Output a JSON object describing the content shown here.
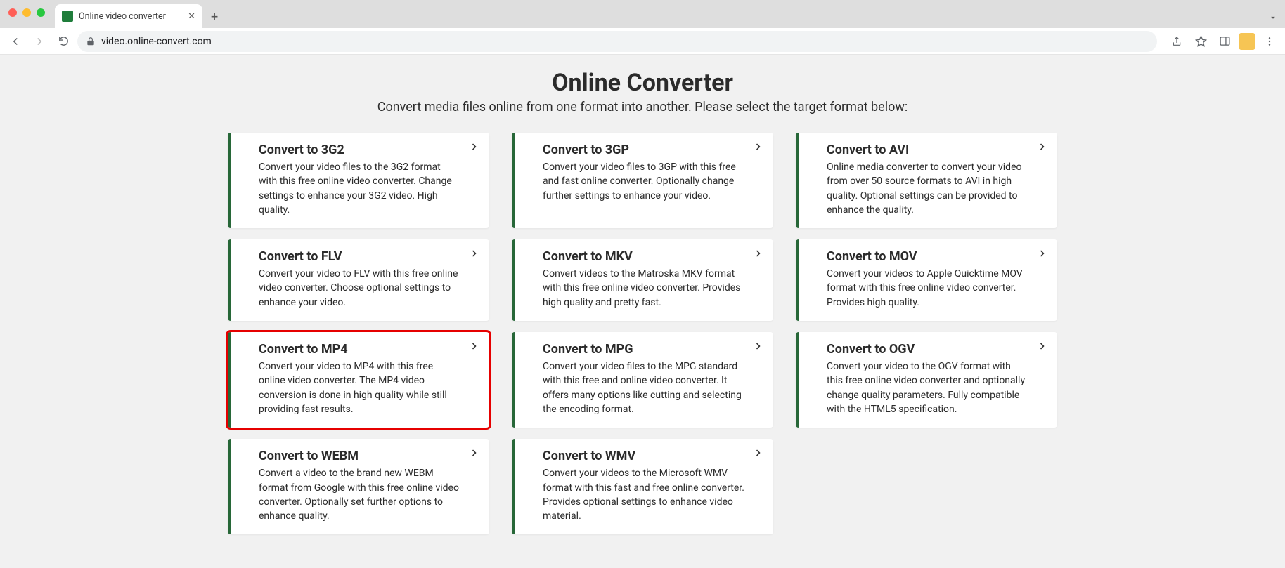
{
  "browser": {
    "tab_title": "Online video converter",
    "url": "video.online-convert.com"
  },
  "page": {
    "title": "Online Converter",
    "subtitle": "Convert media files online from one format into another. Please select the target format below:"
  },
  "cards": [
    {
      "title": "Convert to 3G2",
      "desc": "Convert your video files to the 3G2 format with this free online video converter. Change settings to enhance your 3G2 video. High quality.",
      "highlight": false
    },
    {
      "title": "Convert to 3GP",
      "desc": "Convert your video files to 3GP with this free and fast online converter. Optionally change further settings to enhance your video.",
      "highlight": false
    },
    {
      "title": "Convert to AVI",
      "desc": "Online media converter to convert your video from over 50 source formats to AVI in high quality. Optional settings can be provided to enhance the quality.",
      "highlight": false
    },
    {
      "title": "Convert to FLV",
      "desc": "Convert your video to FLV with this free online video converter. Choose optional settings to enhance your video.",
      "highlight": false
    },
    {
      "title": "Convert to MKV",
      "desc": "Convert videos to the Matroska MKV format with this free online video converter. Provides high quality and pretty fast.",
      "highlight": false
    },
    {
      "title": "Convert to MOV",
      "desc": "Convert your videos to Apple Quicktime MOV format with this free online video converter. Provides high quality.",
      "highlight": false
    },
    {
      "title": "Convert to MP4",
      "desc": "Convert your video to MP4 with this free online video converter. The MP4 video conversion is done in high quality while still providing fast results.",
      "highlight": true
    },
    {
      "title": "Convert to MPG",
      "desc": "Convert your video files to the MPG standard with this free and online video converter. It offers many options like cutting and selecting the encoding format.",
      "highlight": false
    },
    {
      "title": "Convert to OGV",
      "desc": "Convert your video to the OGV format with this free online video converter and optionally change quality parameters. Fully compatible with the HTML5 specification.",
      "highlight": false
    },
    {
      "title": "Convert to WEBM",
      "desc": "Convert a video to the brand new WEBM format from Google with this free online video converter. Optionally set further options to enhance quality.",
      "highlight": false
    },
    {
      "title": "Convert to WMV",
      "desc": "Convert your videos to the Microsoft WMV format with this fast and free online converter. Provides optional settings to enhance video material.",
      "highlight": false
    }
  ]
}
